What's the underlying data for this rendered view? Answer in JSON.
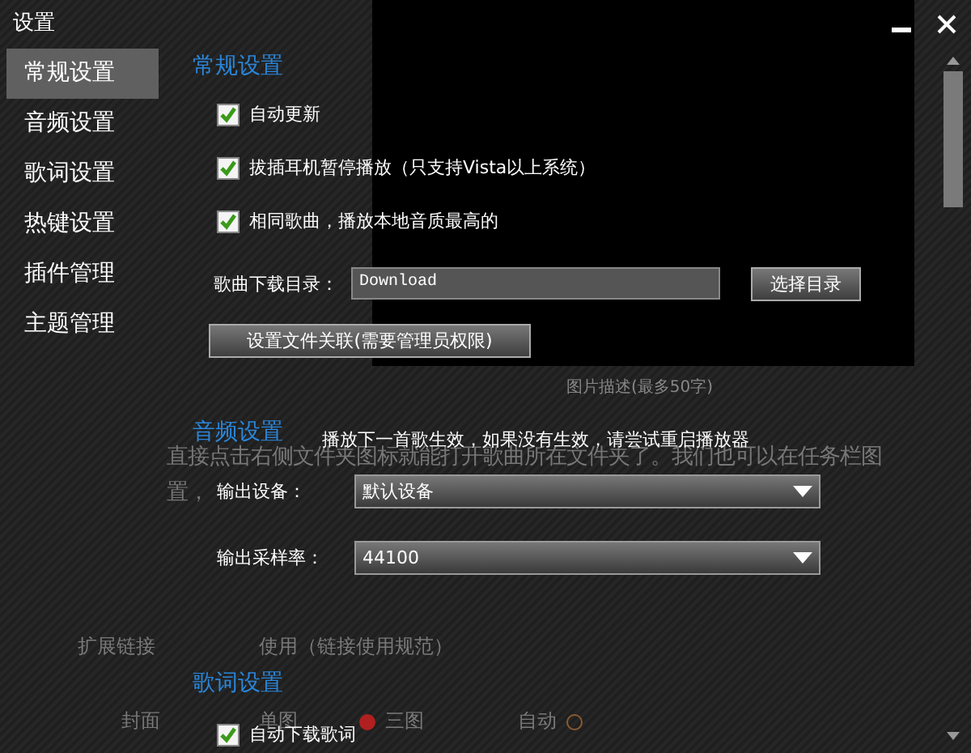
{
  "window": {
    "title": "设置"
  },
  "sidebar": {
    "items": [
      {
        "label": "常规设置",
        "selected": true
      },
      {
        "label": "音频设置",
        "selected": false
      },
      {
        "label": "歌词设置",
        "selected": false
      },
      {
        "label": "热键设置",
        "selected": false
      },
      {
        "label": "插件管理",
        "selected": false
      },
      {
        "label": "主题管理",
        "selected": false
      }
    ]
  },
  "sections": [
    {
      "title": "常规设置",
      "rows": [
        {
          "kind": "checkbox",
          "label": "自动更新",
          "checked": true
        },
        {
          "kind": "checkbox",
          "label": "拔插耳机暂停播放（只支持Vista以上系统）",
          "checked": true
        },
        {
          "kind": "checkbox",
          "label": "相同歌曲，播放本地音质最高的",
          "checked": true
        },
        {
          "kind": "path",
          "label": "歌曲下载目录：",
          "value": "Download",
          "button": "选择目录"
        },
        {
          "kind": "button",
          "label": "设置文件关联(需要管理员权限)"
        }
      ]
    },
    {
      "title": "音频设置",
      "note": "播放下一首歌生效，如果没有生效，请尝试重启播放器",
      "rows": [
        {
          "kind": "select",
          "label": "输出设备：",
          "value": "默认设备"
        },
        {
          "kind": "select",
          "label": "输出采样率：",
          "value": "44100"
        }
      ]
    },
    {
      "title": "歌词设置",
      "rows": [
        {
          "kind": "checkbox",
          "label": "自动下载歌词",
          "checked": true
        }
      ]
    }
  ],
  "background_page": {
    "caption": "图片描述(最多50字)",
    "text_lines": [
      "直接点击右侧文件夹图标就能打开歌曲所在文件夹了。我们也可以在任务栏图",
      "置，"
    ],
    "link_label": "扩展链接",
    "link_value": "使用（链接使用规范）",
    "cover_label": "封面",
    "cover_options": [
      {
        "label": "单图"
      },
      {
        "label": "三图",
        "selected": true
      },
      {
        "label": "自动",
        "selected": false
      }
    ]
  }
}
